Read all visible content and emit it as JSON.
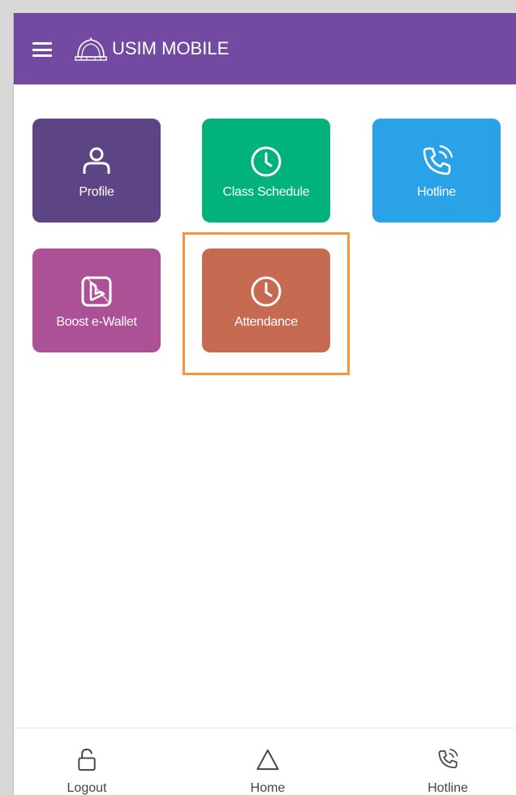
{
  "header": {
    "title": "USIM MOBILE",
    "menu_icon": "hamburger-menu-icon",
    "logo_icon": "usim-logo-icon",
    "background": "#734aa1"
  },
  "tiles": [
    {
      "label": "Profile",
      "icon": "user-icon",
      "color": "#5c4485"
    },
    {
      "label": "Class Schedule",
      "icon": "clock-icon",
      "color": "#02b27b"
    },
    {
      "label": "Hotline",
      "icon": "phone-call-icon",
      "color": "#2aa2e8"
    },
    {
      "label": "Boost e-Wallet",
      "icon": "boost-wallet-icon",
      "color": "#ac5196"
    },
    {
      "label": "Attendance",
      "icon": "clock-icon",
      "color": "#c76a52",
      "highlighted": true
    }
  ],
  "highlight_color": "#f6963b",
  "bottom_nav": [
    {
      "label": "Logout",
      "icon": "unlock-icon"
    },
    {
      "label": "Home",
      "icon": "triangle-home-icon"
    },
    {
      "label": "Hotline",
      "icon": "phone-call-icon"
    }
  ]
}
